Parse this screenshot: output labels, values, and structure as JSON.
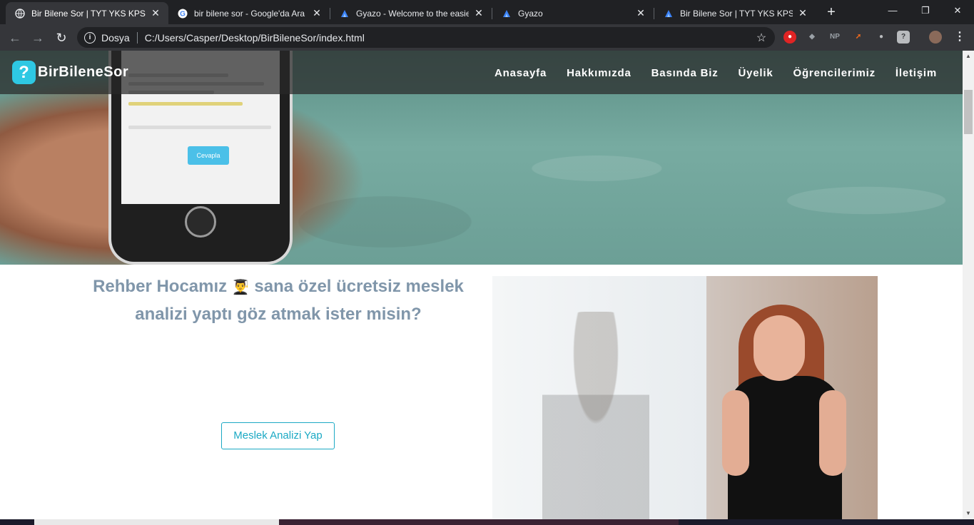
{
  "browser": {
    "tabs": [
      {
        "title": "Bir Bilene Sor | TYT YKS KPSS A",
        "icon": "globe-icon",
        "active": true
      },
      {
        "title": "bir bilene sor - Google'da Ara",
        "icon": "google-icon",
        "active": false
      },
      {
        "title": "Gyazo - Welcome to the easies",
        "icon": "gyazo-icon",
        "active": false
      },
      {
        "title": "Gyazo",
        "icon": "gyazo-icon",
        "active": false
      },
      {
        "title": "Bir Bilene Sor | TYT YKS KPSS A",
        "icon": "gyazo-icon",
        "active": false
      }
    ],
    "new_tab": "+",
    "window_controls": {
      "minimize": "—",
      "restore": "❐",
      "close": "✕"
    },
    "address_bar": {
      "scheme_label": "Dosya",
      "url": "C:/Users/Casper/Desktop/BirBileneSor/index.html"
    },
    "extensions": [
      {
        "name": "ublock-icon",
        "label": "●",
        "color": "#e02424"
      },
      {
        "name": "shield-icon",
        "label": "◆",
        "color": "#9aa0a6"
      },
      {
        "name": "np-extension-icon",
        "label": "NP",
        "color": "#9aa0a6"
      },
      {
        "name": "arrow-extension-icon",
        "label": "➚",
        "color": "#f26b1d"
      },
      {
        "name": "discord-icon",
        "label": "●",
        "color": "#b9bbbe"
      },
      {
        "name": "question-shield-icon",
        "label": "?",
        "color": "#b9bbbe"
      },
      {
        "name": "profile-avatar",
        "label": "",
        "color": "#8a6a5a"
      }
    ],
    "menu_label": "⋮"
  },
  "site": {
    "brand": "BirBileneSor",
    "logo_mark": "?",
    "nav": [
      "Anasayfa",
      "Hakkımızda",
      "Basında Biz",
      "Üyelik",
      "Öğrencilerimiz",
      "İletişim"
    ],
    "phone_button": "Cevapla",
    "headline_part1": "Rehber Hocamız",
    "headline_emoji": "👨‍🎓",
    "headline_part2": "sana özel ücretsiz meslek analizi yaptı göz atmak ister misin?",
    "cta": "Meslek Analizi Yap"
  },
  "colors": {
    "accent": "#1ba9c4",
    "logo": "#2ec8e3",
    "headline": "#8096aa"
  }
}
